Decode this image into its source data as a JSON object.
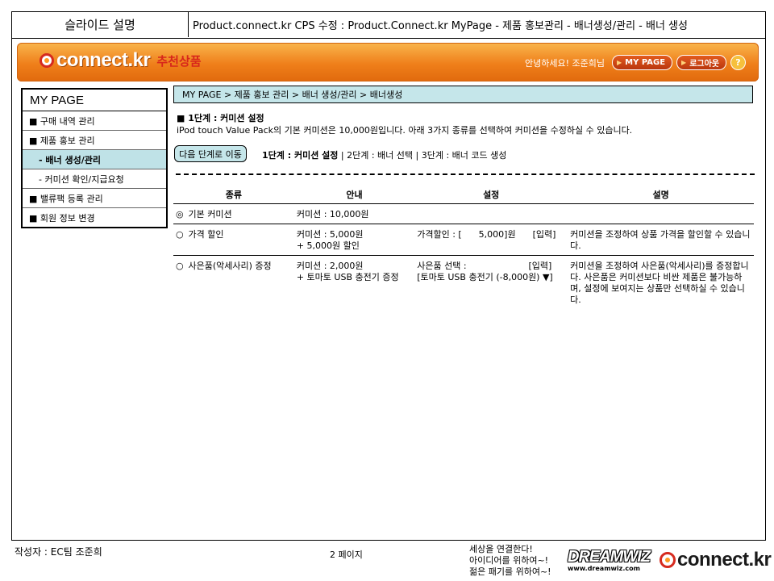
{
  "slide": {
    "title_left": "슬라이드 설명",
    "title_right": "Product.connect.kr CPS 수정 : Product.Connect.kr MyPage - 제품 홍보관리 - 배너생성/관리 - 배너 생성"
  },
  "header": {
    "logo_text": "connect.kr",
    "logo_sub": "추천상품",
    "greeting": "안녕하세요! 조준희님",
    "mypage_btn": "MY PAGE",
    "logout_btn": "로그아웃",
    "help": "?"
  },
  "sidebar": {
    "title": "MY PAGE",
    "items": [
      {
        "label": "■ 구매 내역 관리"
      },
      {
        "label": "■ 제품 홍보 관리"
      },
      {
        "label": "- 배너 생성/관리"
      },
      {
        "label": "- 커미션 확인/지급요청"
      },
      {
        "label": "■ 밸류팩 등록 관리"
      },
      {
        "label": "■ 회원 정보 변경"
      }
    ]
  },
  "main": {
    "breadcrumb": "MY PAGE > 제품 홍보 관리 > 배너 생성/관리 > 배너생성",
    "step_title": "■ 1단계 : 커미션 설정",
    "description": "iPod touch Value Pack의 기본 커미션은 10,000원입니다. 아래 3가지 종류를 선택하여 커미션을 수정하실 수 있습니다.",
    "next_button": "다음 단계로 이동",
    "steps": {
      "current": "1단계 : 커미션 설정",
      "rest": " | 2단계 : 배너 선택 | 3단계 : 배너 코드 생성"
    },
    "table": {
      "headers": [
        "종류",
        "안내",
        "설정",
        "설명"
      ],
      "rows": [
        {
          "radio": "◎",
          "type": "기본 커미션",
          "info1": "커미션 : 10,000원",
          "info2": "",
          "set1": "",
          "set2": "",
          "desc": ""
        },
        {
          "radio": "○",
          "type": "가격 할인",
          "info1": "커미션 : 5,000원",
          "info2": "+ 5,000원 할인",
          "set1": "가격할인 : [      5,000]원      [입력]",
          "set2": "",
          "desc": "커미션을 조정하여 상품 가격을 할인할 수 있습니다."
        },
        {
          "radio": "○",
          "type": "사은품(악세사리) 증정",
          "info1": "커미션 : 2,000원",
          "info2": "+ 토마토 USB 충전기 증정",
          "set1": "사은품 선택 :                      [입력]",
          "set2": "[토마토 USB 충전기 (-8,000원) ▼]",
          "desc": "커미션을 조정하여 사은품(악세사리)를 증정합니다. 사은품은 커미션보다 비싼 제품은 불가능하며, 설정에 보여지는 상품만 선택하실 수 있습니다."
        }
      ]
    }
  },
  "footer": {
    "author": "작성자 : EC팀 조준희",
    "page": "2 페이지",
    "slogan_1": "세상을 연결한다!",
    "slogan_2": "아이디어를 위하여~!",
    "slogan_3": "젊은 패기를 위하여~!",
    "dreamwiz": "DREAMWIZ",
    "dreamwiz_url": "www.dreamwiz.com",
    "logo_text": "connect.kr"
  },
  "colors": {
    "header_orange": "#ef7f1a",
    "accent_teal": "#c5e6ea",
    "logo_red": "#d62b1f"
  }
}
